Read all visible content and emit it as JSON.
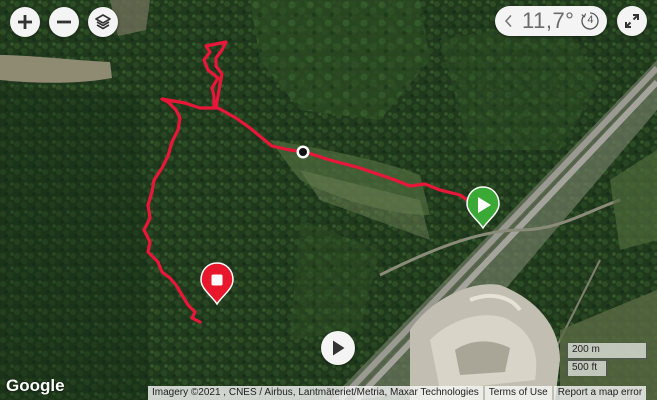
{
  "controls": {
    "zoom_in_icon": "plus-icon",
    "zoom_out_icon": "minus-icon",
    "layers_icon": "layers-icon",
    "fullscreen_icon": "expand-icon"
  },
  "weather": {
    "temperature": "11,7°",
    "forecast_days": "4"
  },
  "route": {
    "color": "#e8173a",
    "start_marker_color": "#3aa935",
    "end_marker_color": "#e8172c"
  },
  "playback": {
    "icon": "play-icon"
  },
  "branding": {
    "logo_text": "Google"
  },
  "scale": {
    "metric": "200 m",
    "imperial": "500 ft"
  },
  "footer": {
    "attribution": "Imagery ©2021 , CNES / Airbus, Lantmäteriet/Metria, Maxar Technologies",
    "terms": "Terms of Use",
    "report": "Report a map error"
  }
}
